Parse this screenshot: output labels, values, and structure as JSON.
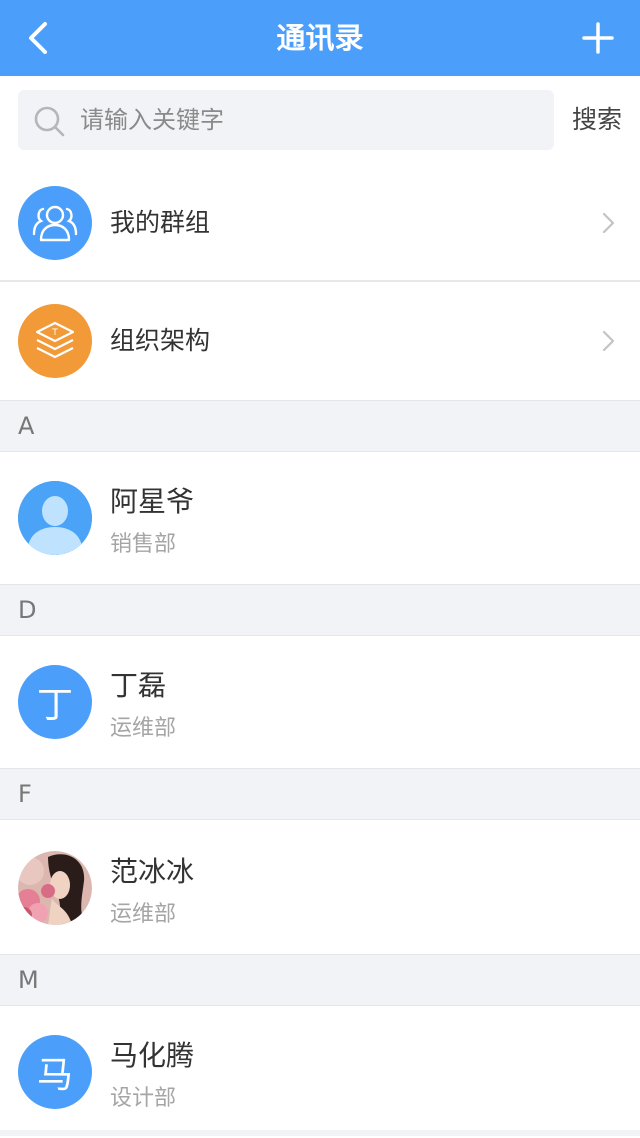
{
  "header": {
    "title": "通讯录",
    "back_icon": "chevron-left-icon",
    "add_icon": "plus-icon",
    "bg_color": "#4b9ffa"
  },
  "search": {
    "placeholder": "请输入关键字",
    "value": "",
    "button_label": "搜索",
    "icon": "search-icon"
  },
  "entries": [
    {
      "label": "我的群组",
      "icon": "group-icon",
      "color": "#4b9ffa"
    },
    {
      "label": "组织架构",
      "icon": "layers-icon",
      "color": "#f19a37"
    }
  ],
  "sections": [
    {
      "letter": "A",
      "contacts": [
        {
          "name": "阿星爷",
          "dept": "销售部",
          "avatar": "person-silhouette"
        }
      ]
    },
    {
      "letter": "D",
      "contacts": [
        {
          "name": "丁磊",
          "dept": "运维部",
          "avatar_text": "丁"
        }
      ]
    },
    {
      "letter": "F",
      "contacts": [
        {
          "name": "范冰冰",
          "dept": "运维部",
          "avatar": "photo"
        }
      ]
    },
    {
      "letter": "M",
      "contacts": [
        {
          "name": "马化腾",
          "dept": "设计部",
          "avatar_text": "马"
        }
      ]
    }
  ]
}
